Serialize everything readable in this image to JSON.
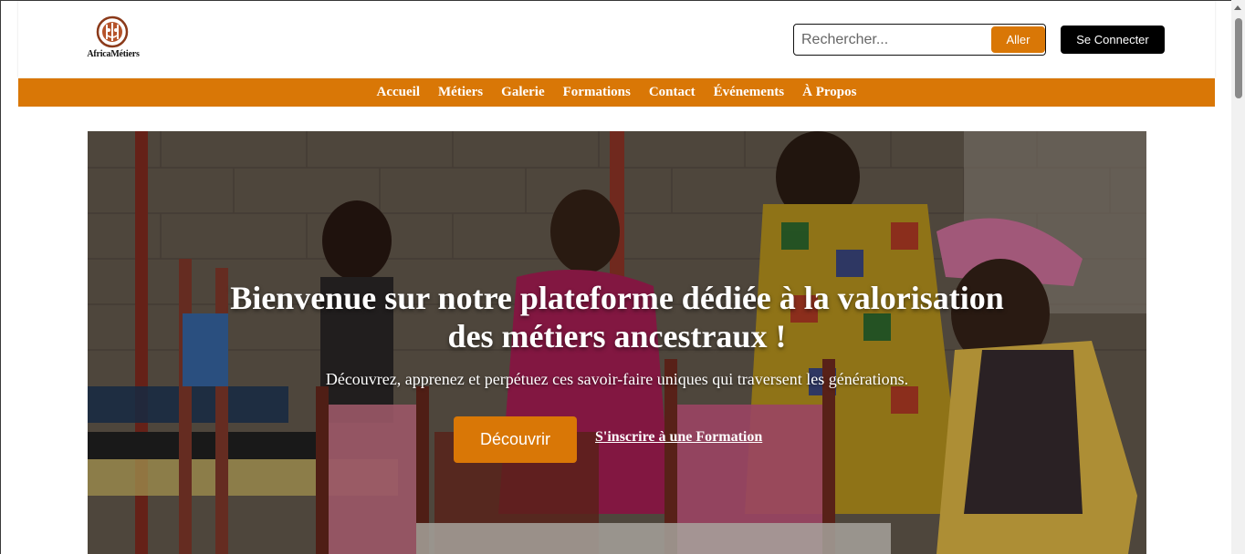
{
  "brand": {
    "name": "AfricaMétiers",
    "logo_icon": "tribal-mask-logo-icon"
  },
  "search": {
    "placeholder": "Rechercher...",
    "button_label": "Aller"
  },
  "auth": {
    "login_label": "Se Connecter"
  },
  "nav": {
    "items": [
      {
        "label": "Accueil"
      },
      {
        "label": "Métiers"
      },
      {
        "label": "Galerie"
      },
      {
        "label": "Formations"
      },
      {
        "label": "Contact"
      },
      {
        "label": "Événements"
      },
      {
        "label": "À Propos"
      }
    ]
  },
  "hero": {
    "title": "Bienvenue sur notre plateforme dédiée à la valorisation des métiers ancestraux !",
    "subtitle": "Découvrez, apprenez et perpétuez ces savoir-faire uniques qui traversent les générations.",
    "primary_cta": "Découvrir",
    "secondary_cta": "S'inscrire à une Formation"
  },
  "colors": {
    "accent": "#d97706",
    "dark": "#000000",
    "text_light": "#ffffff"
  }
}
